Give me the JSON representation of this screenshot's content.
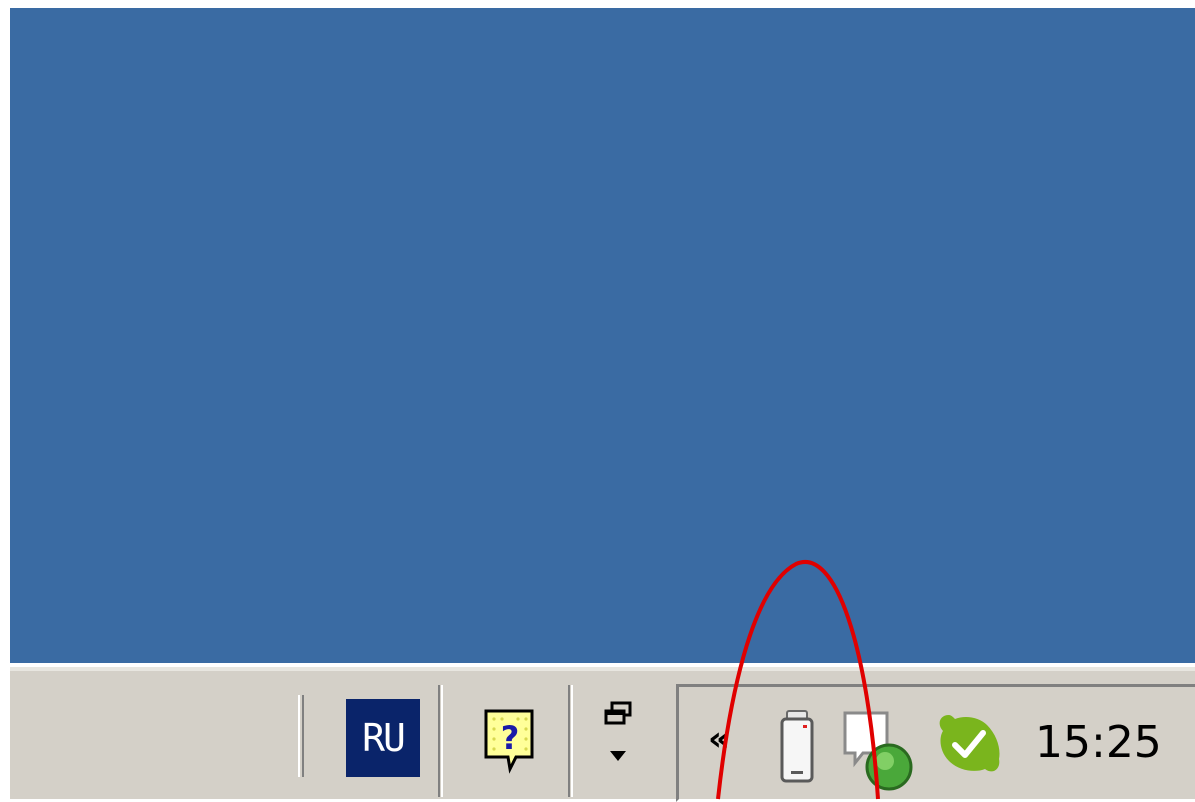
{
  "taskbar": {
    "language_indicator": "RU",
    "help_icon": "help-question-icon",
    "desktop_toolbar_icon": "show-desktop-icon"
  },
  "tray": {
    "expand_label": "«",
    "icons": [
      "usb-device-icon",
      "messenger-status-icon",
      "skype-online-icon"
    ],
    "clock_time": "15:25"
  },
  "annotation": {
    "shape": "ellipse",
    "color": "#e00000"
  },
  "colors": {
    "desktop_background": "#3a6ba3",
    "taskbar_background": "#d4d0c8",
    "language_background": "#0a246a"
  }
}
